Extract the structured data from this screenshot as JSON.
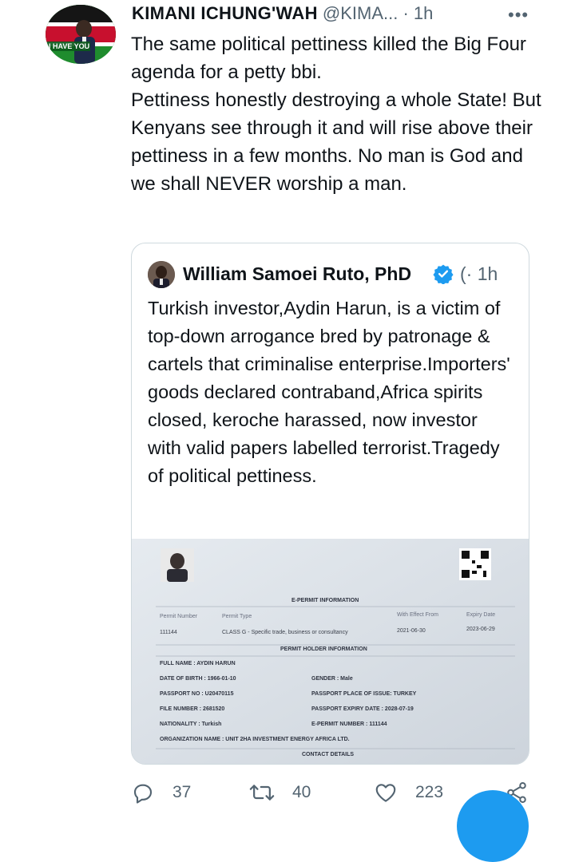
{
  "tweet": {
    "author_name": "KIMANI ICHUNG'WAH",
    "author_handle": "@KIMA...",
    "time": "· 1h",
    "more": "•••",
    "avatar_badge": "I HAVE YOU",
    "text": [
      "The same political pettiness killed the Big Four agenda for a petty bbi.",
      "Pettiness honestly destroying a whole State! But Kenyans see through it and will rise above their pettiness in a few months. No man is God and we shall NEVER worship a man."
    ]
  },
  "quote": {
    "author_name": "William Samoei Ruto, PhD",
    "meta": "(· 1h",
    "text": "Turkish investor,Aydin Harun, is a victim of top-down arrogance bred by patronage & cartels that criminalise enterprise.Importers' goods declared contraband,Africa spirits closed, keroche harassed, now investor with valid papers labelled terrorist.Tragedy of political pettiness.",
    "permit": {
      "heading": "E-PERMIT INFORMATION",
      "columns": [
        "Permit Number",
        "Permit Type",
        "With Effect From",
        "Expiry Date"
      ],
      "values": [
        "111144",
        "CLASS G - Specific trade, business or consultancy",
        "2021-06-30",
        "2023-06-29"
      ],
      "holder_heading": "PERMIT HOLDER INFORMATION",
      "full_name": "FULL NAME : AYDIN HARUN",
      "dob": "DATE OF BIRTH : 1966-01-10",
      "gender": "GENDER : Male",
      "passport_no": "PASSPORT NO : U20470115",
      "place_of_issue": "PASSPORT PLACE OF ISSUE: TURKEY",
      "file_number": "FILE NUMBER : 2681520",
      "expiry": "PASSPORT EXPIRY DATE : 2028-07-19",
      "nationality": "NATIONALITY : Turkish",
      "epermit_number": "E-PERMIT NUMBER : 111144",
      "organization": "ORGANIZATION NAME : UNIT 2HA INVESTMENT ENERGY AFRICA LTD.",
      "contact": "CONTACT DETAILS"
    }
  },
  "actions": {
    "replies": "37",
    "retweets": "40",
    "likes": "223"
  },
  "colors": {
    "text": "#0f1419",
    "secondary": "#536471",
    "border": "#cfd9de",
    "accent": "#1d9bf0"
  },
  "icons": [
    "reply-icon",
    "retweet-icon",
    "like-icon",
    "share-icon",
    "verified-badge-icon",
    "more-icon"
  ]
}
